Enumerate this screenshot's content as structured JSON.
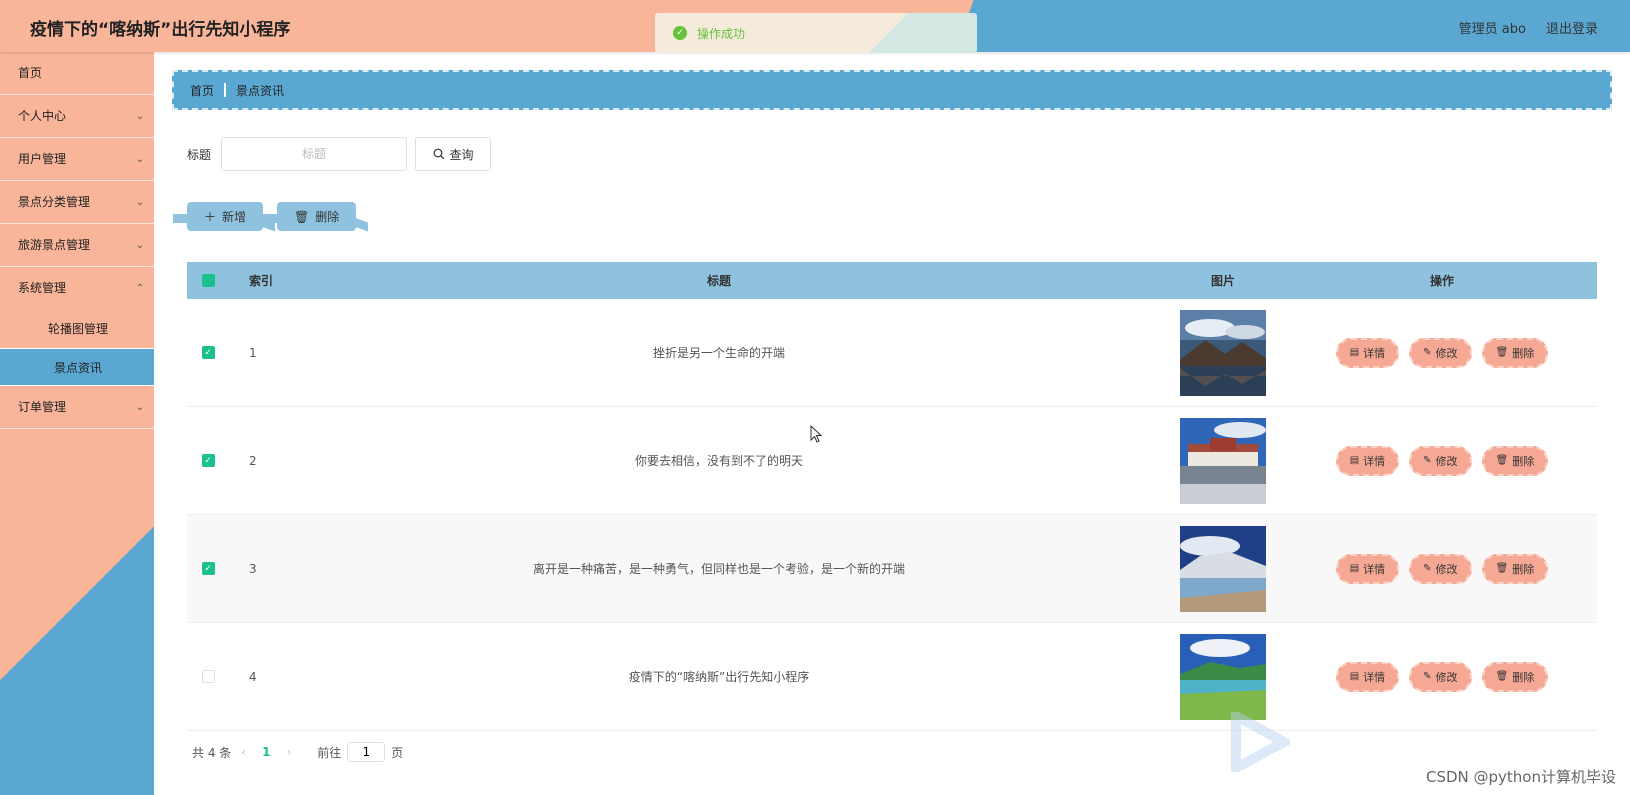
{
  "app": {
    "title": "疫情下的“喀纳斯”出行先知小程序"
  },
  "header": {
    "admin": "管理员 abo",
    "logout": "退出登录"
  },
  "toast": {
    "message": "操作成功"
  },
  "sidebar": {
    "items": [
      {
        "label": "首页"
      },
      {
        "label": "个人中心"
      },
      {
        "label": "用户管理"
      },
      {
        "label": "景点分类管理"
      },
      {
        "label": "旅游景点管理"
      },
      {
        "label": "系统管理"
      },
      {
        "label": "订单管理"
      }
    ],
    "sub_items": [
      {
        "label": "轮播图管理"
      },
      {
        "label": "景点资讯"
      }
    ]
  },
  "breadcrumb": {
    "home": "首页",
    "current": "景点资讯"
  },
  "search": {
    "label": "标题",
    "placeholder": "标题",
    "button": "查询"
  },
  "actions": {
    "add": "新增",
    "delete": "删除"
  },
  "table": {
    "headers": {
      "index": "索引",
      "title": "标题",
      "image": "图片",
      "ops": "操作"
    },
    "rows": [
      {
        "index": "1",
        "title": "挫折是另一个生命的开端",
        "checked": true
      },
      {
        "index": "2",
        "title": "你要去相信，没有到不了的明天",
        "checked": true
      },
      {
        "index": "3",
        "title": "离开是一种痛苦，是一种勇气，但同样也是一个考验，是一个新的开端",
        "checked": true
      },
      {
        "index": "4",
        "title": "疫情下的“喀纳斯”出行先知小程序",
        "checked": false
      }
    ],
    "ops": {
      "detail": "详情",
      "edit": "修改",
      "delete": "删除"
    }
  },
  "pagination": {
    "total": "共 4 条",
    "current_page": "1",
    "goto": "前往",
    "page_input": "1",
    "page_unit": "页"
  },
  "watermark": "CSDN @python计算机毕设",
  "colors": {
    "salmon": "#f9b59a",
    "blue": "#5aa8d2",
    "light_blue": "#8fc2de",
    "green": "#1cbf8e",
    "op_button": "#f5a995"
  },
  "icons": [
    "check-circle-icon",
    "chevron-down-icon",
    "search-icon",
    "plus-icon",
    "trash-icon",
    "document-icon",
    "edit-icon",
    "mouse-cursor-icon"
  ]
}
